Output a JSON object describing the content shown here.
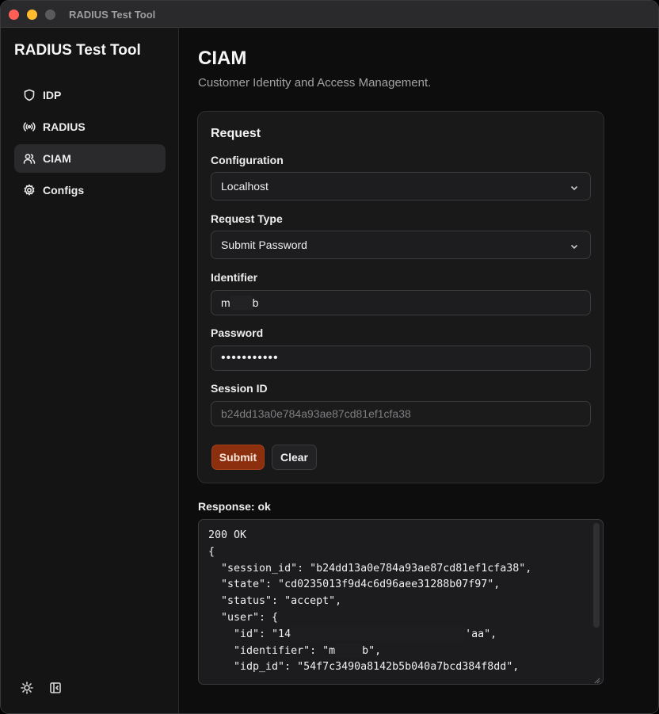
{
  "window": {
    "title": "RADIUS Test Tool"
  },
  "sidebar": {
    "app_title": "RADIUS Test Tool",
    "items": [
      {
        "label": "IDP",
        "icon": "shield-icon",
        "active": false
      },
      {
        "label": "RADIUS",
        "icon": "broadcast-icon",
        "active": false
      },
      {
        "label": "CIAM",
        "icon": "users-icon",
        "active": true
      },
      {
        "label": "Configs",
        "icon": "gear-icon",
        "active": false
      }
    ],
    "footer_icons": [
      "sun-icon",
      "sidebar-collapse-icon"
    ]
  },
  "main": {
    "title": "CIAM",
    "subtitle": "Customer Identity and Access Management."
  },
  "request": {
    "title": "Request",
    "configuration": {
      "label": "Configuration",
      "value": "Localhost"
    },
    "request_type": {
      "label": "Request Type",
      "value": "Submit Password"
    },
    "identifier": {
      "label": "Identifier",
      "prefix": "m",
      "suffix": "b"
    },
    "password": {
      "label": "Password",
      "value": "•••••••••••"
    },
    "session_id": {
      "label": "Session ID",
      "value": "b24dd13a0e784a93ae87cd81ef1cfa38"
    },
    "submit_label": "Submit",
    "clear_label": "Clear"
  },
  "response": {
    "label": "Response: ok",
    "lines": [
      "200 OK",
      "",
      "{",
      "  \"session_id\": \"b24dd13a0e784a93ae87cd81ef1cfa38\",",
      "  \"state\": \"cd0235013f9d4c6d96aee31288b07f97\",",
      "  \"status\": \"accept\",",
      "  \"user\": {",
      "    \"id\": \"14",
      "    \"identifier\": \"m",
      "    \"idp_id\": \"54f7c3490a8142b5b040a7bcd384f8dd\","
    ],
    "id_line_end": "'aa\",",
    "identifier_line_end": "b\","
  },
  "colors": {
    "accent": "#8b2f0e",
    "background": "#0d0d0e",
    "sidebar": "#141415",
    "card": "#19191a"
  }
}
